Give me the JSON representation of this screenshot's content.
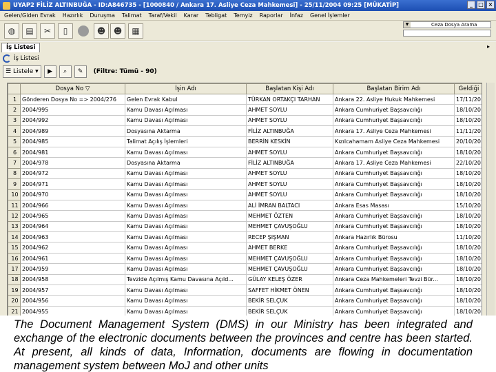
{
  "window": {
    "title": "UYAP2 FİLİZ ALTINBUĞA - ID:A846735 - [1000840 / Ankara 17. Asliye Ceza Mahkemesi] - 25/11/2004 09:25 [MÜKATİP]",
    "minimize": "_",
    "maximize": "□",
    "close": "×"
  },
  "menu": [
    "Gelen/Giden Evrak",
    "Hazırlık",
    "Duruşma",
    "Talimat",
    "Taraf/Vekil",
    "Karar",
    "Tebligat",
    "Temyiz",
    "Raporlar",
    "İnfaz",
    "Genel İşlemler"
  ],
  "toolbar": {
    "icons": [
      "globe-icon",
      "document-icon",
      "scissors-icon",
      "clipboard-icon",
      "stop-icon",
      "people-icon",
      "people2-icon",
      "grid-icon"
    ],
    "combo_label": "Ceza Dosya Arama"
  },
  "tab": {
    "label": "İş Listesi"
  },
  "panel": {
    "title": "İş Listesi",
    "list_button": "Listele",
    "filter": "(Filtre: Tümü - 90)"
  },
  "columns": [
    "",
    "Dosya No",
    "İşin Adı",
    "Başlatan Kişi Adı",
    "Başlatan Birim Adı",
    "Geldiği"
  ],
  "rows": [
    [
      "1",
      "Gönderen Dosya No => 2004/276",
      "Gelen Evrak Kabul",
      "TÜRKAN ORTAKÇI TARHAN",
      "Ankara 22. Asliye Hukuk Mahkemesi",
      "17/11/20"
    ],
    [
      "2",
      "2004/995",
      "Kamu Davası Açılması",
      "AHMET SOYLU",
      "Ankara Cumhuriyet Başsavcılığı",
      "18/10/20"
    ],
    [
      "3",
      "2004/992",
      "Kamu Davası Açılması",
      "AHMET SOYLU",
      "Ankara Cumhuriyet Başsavcılığı",
      "18/10/20"
    ],
    [
      "4",
      "2004/989",
      "Dosyasına Aktarma",
      "FİLİZ ALTINBUĞA",
      "Ankara 17. Asliye Ceza Mahkemesi",
      "11/11/20"
    ],
    [
      "5",
      "2004/985",
      "Talimat Açılış İşlemleri",
      "BERRİN KESKİN",
      "Kızılcahamam Asliye Ceza Mahkemesi",
      "20/10/20"
    ],
    [
      "6",
      "2004/981",
      "Kamu Davası Açılması",
      "AHMET SOYLU",
      "Ankara Cumhuriyet Başsavcılığı",
      "18/10/20"
    ],
    [
      "7",
      "2004/978",
      "Dosyasına Aktarma",
      "FİLİZ ALTINBUĞA",
      "Ankara 17. Asliye Ceza Mahkemesi",
      "22/10/20"
    ],
    [
      "8",
      "2004/972",
      "Kamu Davası Açılması",
      "AHMET SOYLU",
      "Ankara Cumhuriyet Başsavcılığı",
      "18/10/20"
    ],
    [
      "9",
      "2004/971",
      "Kamu Davası Açılması",
      "AHMET SOYLU",
      "Ankara Cumhuriyet Başsavcılığı",
      "18/10/20"
    ],
    [
      "10",
      "2004/970",
      "Kamu Davası Açılması",
      "AHMET SOYLU",
      "Ankara Cumhuriyet Başsavcılığı",
      "18/10/20"
    ],
    [
      "11",
      "2004/966",
      "Kamu Davası Açılması",
      "ALİ İMRAN BALTACI",
      "Ankara Esas Masası",
      "15/10/20"
    ],
    [
      "12",
      "2004/965",
      "Kamu Davası Açılması",
      "MEHMET ÖZTEN",
      "Ankara Cumhuriyet Başsavcılığı",
      "18/10/20"
    ],
    [
      "13",
      "2004/964",
      "Kamu Davası Açılması",
      "MEHMET ÇAVUŞOĞLU",
      "Ankara Cumhuriyet Başsavcılığı",
      "18/10/20"
    ],
    [
      "14",
      "2004/963",
      "Kamu Davası Açılması",
      "RECEP ŞIŞMAN",
      "Ankara Hazırlık Bürosu",
      "11/10/20"
    ],
    [
      "15",
      "2004/962",
      "Kamu Davası Açılması",
      "AHMET BERKE",
      "Ankara Cumhuriyet Başsavcılığı",
      "18/10/20"
    ],
    [
      "16",
      "2004/961",
      "Kamu Davası Açılması",
      "MEHMET ÇAVUŞOĞLU",
      "Ankara Cumhuriyet Başsavcılığı",
      "18/10/20"
    ],
    [
      "17",
      "2004/959",
      "Kamu Davası Açılması",
      "MEHMET ÇAVUŞOĞLU",
      "Ankara Cumhuriyet Başsavcılığı",
      "18/10/20"
    ],
    [
      "18",
      "2004/958",
      "Tevzide Açılmış Kamu Davasına Açıld...",
      "GÜLAY KELEŞ ÖZER",
      "Ankara Ceza Mahkemeleri Tevzi Bür...",
      "18/10/20"
    ],
    [
      "19",
      "2004/957",
      "Kamu Davası Açılması",
      "SAFFET HİKMET ÖNEN",
      "Ankara Cumhuriyet Başsavcılığı",
      "18/10/20"
    ],
    [
      "20",
      "2004/956",
      "Kamu Davası Açılması",
      "BEKİR SELÇUK",
      "Ankara Cumhuriyet Başsavcılığı",
      "18/10/20"
    ],
    [
      "21",
      "2004/955",
      "Kamu Davası Açılması",
      "BEKİR SELÇUK",
      "Ankara Cumhuriyet Başsavcılığı",
      "18/10/20"
    ]
  ],
  "caption": "The Document Management System (DMS) in our Ministry has been integrated and exchange of the electronic documents between the provinces and centre has been started. At present, all kinds of data, Information, documents are flowing in documentation management system between MoJ and other units"
}
